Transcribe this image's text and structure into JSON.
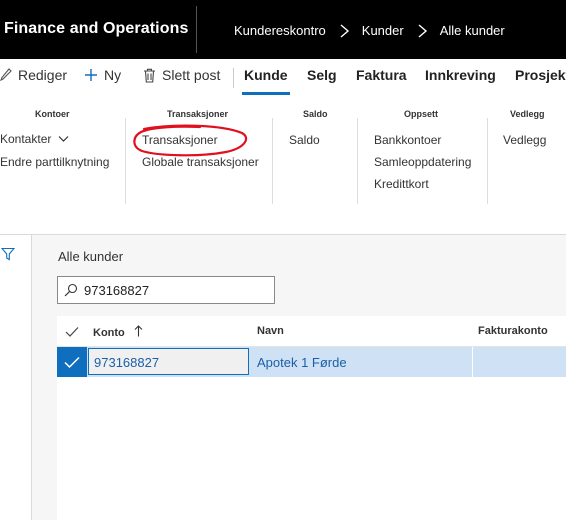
{
  "app": {
    "title": "Finance and Operations"
  },
  "breadcrumb": [
    "Kundereskontro",
    "Kunder",
    "Alle kunder"
  ],
  "actions": {
    "edit": "Rediger",
    "new": "Ny",
    "delete": "Slett post"
  },
  "tabs": [
    "Kunde",
    "Selg",
    "Faktura",
    "Innkreving",
    "Prosjekt"
  ],
  "active_tab": "Kunde",
  "ribbon": {
    "groups": [
      {
        "title": "Kontoer",
        "items": [
          "Kontakter",
          "Endre parttilknytning"
        ]
      },
      {
        "title": "Transaksjoner",
        "items": [
          "Transaksjoner",
          "Globale transaksjoner"
        ]
      },
      {
        "title": "Saldo",
        "items": [
          "Saldo"
        ]
      },
      {
        "title": "Oppsett",
        "items": [
          "Bankkontoer",
          "Samleoppdatering",
          "Kredittkort"
        ]
      },
      {
        "title": "Vedlegg",
        "items": [
          "Vedlegg"
        ]
      }
    ]
  },
  "annotation_color": "#e0101e",
  "list": {
    "title": "Alle kunder",
    "search_value": "973168827",
    "columns": [
      "Konto",
      "Navn",
      "Fakturakonto"
    ],
    "rows": [
      {
        "konto": "973168827",
        "navn": "Apotek 1 Førde",
        "fakturakonto": ""
      }
    ]
  },
  "colors": {
    "accent": "#106ebe",
    "selected_row": "#cfe1f5",
    "topbar": "#000000"
  }
}
